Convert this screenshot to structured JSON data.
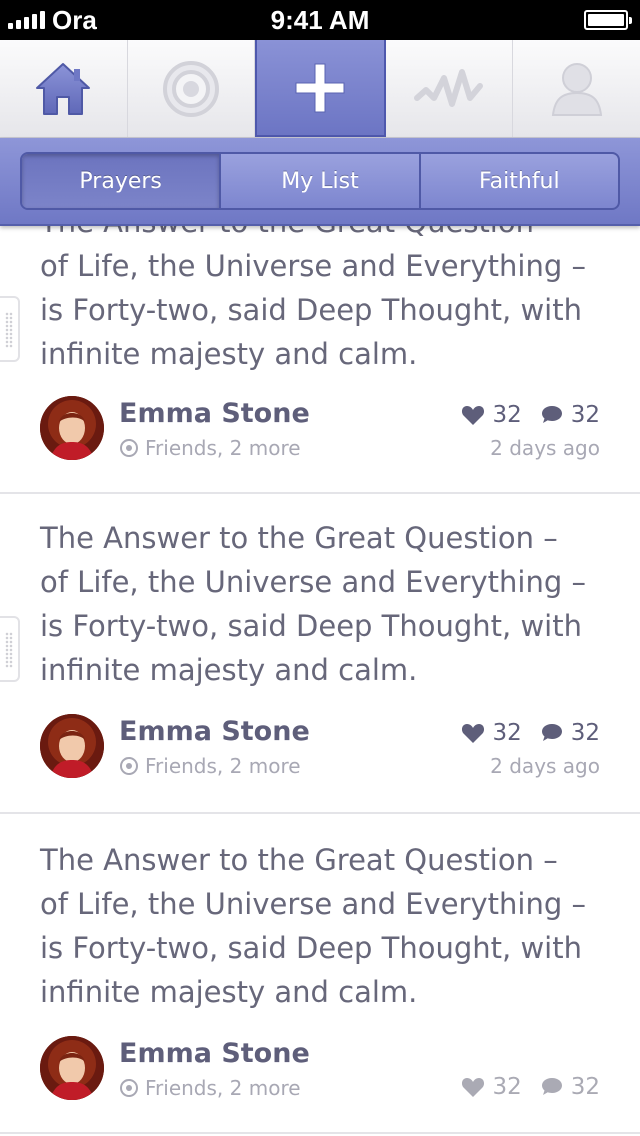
{
  "status_bar": {
    "carrier": "Ora",
    "time": "9:41 AM"
  },
  "tab_bar": {
    "tabs": [
      {
        "icon": "home-icon"
      },
      {
        "icon": "target-icon"
      },
      {
        "icon": "plus-icon",
        "active": true
      },
      {
        "icon": "activity-icon"
      },
      {
        "icon": "profile-icon"
      }
    ]
  },
  "segments": [
    {
      "label": "Prayers",
      "active": true
    },
    {
      "label": "My List"
    },
    {
      "label": "Faithful"
    }
  ],
  "posts": [
    {
      "text_lines": [
        "The Answer to the Great Question –",
        "of Life, the Universe and Everything –",
        "is Forty-two, said Deep Thought, with",
        "infinite majesty and calm."
      ],
      "author": "Emma Stone",
      "audience": "Friends, 2 more",
      "likes": "32",
      "comments": "32",
      "time_ago": "2 days ago"
    },
    {
      "text_lines": [
        "The Answer to the Great Question –",
        "of Life, the Universe and Everything –",
        "is Forty-two, said Deep Thought, with",
        "infinite majesty and calm."
      ],
      "author": "Emma Stone",
      "audience": "Friends, 2 more",
      "likes": "32",
      "comments": "32",
      "time_ago": "2 days ago"
    },
    {
      "text_lines": [
        "The Answer to the Great Question –",
        "of Life, the Universe and Everything –",
        "is Forty-two, said Deep Thought, with",
        "infinite majesty and calm."
      ],
      "author": "Emma Stone",
      "audience": "Friends, 2 more",
      "likes": "32",
      "comments": "32",
      "time_ago": ""
    }
  ],
  "colors": {
    "accent": "#6f78c5",
    "accent_dark": "#4f59a6",
    "text": "#67677a",
    "meta": "#a8a8b4"
  }
}
